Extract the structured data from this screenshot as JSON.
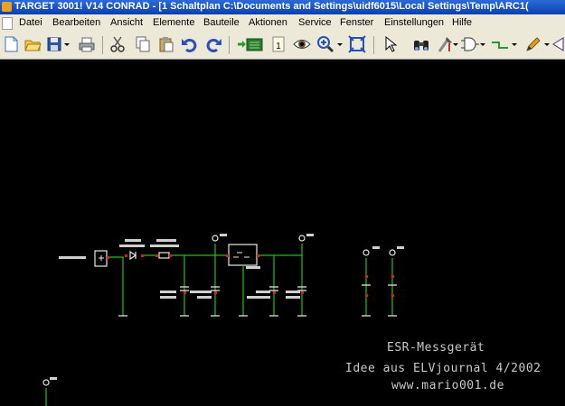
{
  "window": {
    "title": "TARGET 3001! V14 CONRAD - [1 Schaltplan C:\\Documents and Settings\\uidf6015\\Local Settings\\Temp\\ARC1("
  },
  "menu": {
    "items": [
      "Datei",
      "Bearbeiten",
      "Ansicht",
      "Elemente",
      "Bauteile",
      "Aktionen",
      "Service",
      "Fenster",
      "Einstellungen",
      "Hilfe"
    ]
  },
  "toolbar": {
    "buttons": [
      {
        "icon": "new-document-icon"
      },
      {
        "icon": "open-folder-icon"
      },
      {
        "icon": "save-disk-icon"
      },
      {
        "icon": "print-icon"
      },
      {
        "icon": "cut-icon"
      },
      {
        "icon": "copy-icon"
      },
      {
        "icon": "paste-icon"
      },
      {
        "icon": "undo-icon"
      },
      {
        "icon": "redo-icon"
      },
      {
        "icon": "component-import-icon"
      },
      {
        "icon": "page-one-icon"
      },
      {
        "icon": "eye-view-icon"
      },
      {
        "icon": "zoom-in-icon"
      },
      {
        "icon": "zoom-fit-icon"
      },
      {
        "icon": "pointer-select-icon"
      },
      {
        "icon": "binoculars-find-icon"
      },
      {
        "icon": "tools-icon"
      },
      {
        "icon": "logic-gate-icon"
      },
      {
        "icon": "wire-icon"
      },
      {
        "icon": "pen-draw-icon"
      },
      {
        "icon": "nav-arrow-icon"
      }
    ]
  },
  "schematic": {
    "notes": [
      {
        "text": "ESR-Messgerät"
      },
      {
        "text": "Idee aus ELVjournal 4/2002"
      },
      {
        "text": "www.mario001.de"
      }
    ],
    "colors": {
      "background": "#000000",
      "wire": "#19c419",
      "part": "#e8e8e8",
      "pin": "#e01818",
      "label": "#c8c8c8"
    }
  }
}
